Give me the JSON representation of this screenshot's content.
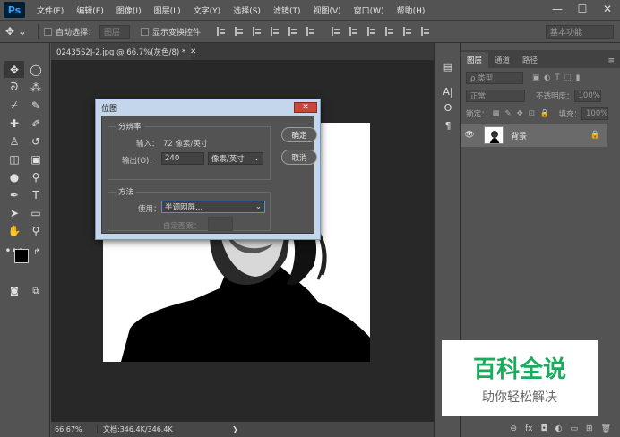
{
  "app": {
    "logo": "Ps",
    "colors": {
      "accent": "#31a8ff",
      "dialog_title_bg": "#c4d6ec"
    }
  },
  "menu": [
    "文件(F)",
    "编辑(E)",
    "图像(I)",
    "图层(L)",
    "文字(Y)",
    "选择(S)",
    "滤镜(T)",
    "视图(V)",
    "窗口(W)",
    "帮助(H)"
  ],
  "window_controls": {
    "minimize": "—",
    "maximize": "☐",
    "close": "✕"
  },
  "options": {
    "auto_select_label": "自动选择：",
    "auto_select_value": "图层",
    "transform_label": "显示变换控件",
    "workspace": "基本功能"
  },
  "document": {
    "tab_title": "02435S2J-2.jpg @ 66.7%(灰色/8) *",
    "zoom": "66.67%",
    "doc_info": "文档:346.4K/346.4K"
  },
  "dialog": {
    "title": "位图",
    "resolution_group": "分辨率",
    "input_label": "输入：",
    "input_value": "72 像素/英寸",
    "output_label": "输出(O)：",
    "output_value": "240",
    "output_unit": "像素/英寸",
    "method_group": "方法",
    "use_label": "使用：",
    "use_value": "半调网屏...",
    "custom_pattern_label": "自定图案：",
    "ok_label": "确定",
    "cancel_label": "取消"
  },
  "panel": {
    "tabs": [
      "图层",
      "通道",
      "路径"
    ],
    "filter_kind": "ρ 类型",
    "blend_mode": "正常",
    "opacity_label": "不透明度：",
    "opacity_value": "100%",
    "lock_label": "锁定：",
    "fill_label": "填充：",
    "fill_value": "100%",
    "layer_name": "背景"
  },
  "watermark": {
    "title": "百科全说",
    "subtitle": "助你轻松解决"
  }
}
